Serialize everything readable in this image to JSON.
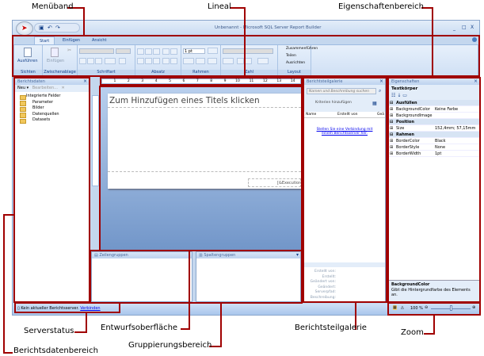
{
  "window": {
    "title": "Unbenannt - Microsoft SQL Server Report Builder"
  },
  "ribbon": {
    "tabs": [
      {
        "label": "Start"
      },
      {
        "label": "Einfügen"
      },
      {
        "label": "Ansicht"
      }
    ],
    "groups": {
      "sichten": "Sichten",
      "zwischenablage": "Zwischenablage",
      "schriftart": "Schriftart",
      "absatz": "Absatz",
      "rahmen": "Rahmen",
      "zahl": "Zahl",
      "layout": "Layout"
    },
    "run_label": "Ausführen",
    "paste_label": "Einfügen",
    "border_width": "1 pt",
    "layout_items": [
      "Zusammenführen",
      "Teilen",
      "Ausrichten"
    ]
  },
  "report_data": {
    "title": "Berichtsdaten",
    "new_label": "Neu",
    "edit_label": "Bearbeiten...",
    "items": [
      "Integrierte Felder",
      "Parameter",
      "Bilder",
      "Datenquellen",
      "Datasets"
    ]
  },
  "ruler": {
    "ticks": [
      "1",
      "2",
      "3",
      "4",
      "5",
      "6",
      "7",
      "8",
      "9",
      "10",
      "11",
      "12",
      "13",
      "14"
    ]
  },
  "design": {
    "title_placeholder": "Zum Hinzufügen eines Titels klicken",
    "footer_expr": "[&ExecutionTime]"
  },
  "grouping": {
    "row_groups": "Zeilengruppen",
    "column_groups": "Spaltengruppen"
  },
  "gallery": {
    "title": "Berichtsteilgalerie",
    "search_placeholder": "Namen und Beschreibung suchen",
    "add_criteria": "Kriterien hinzufügen",
    "columns": [
      "Name",
      "Erstellt von",
      "Geä"
    ],
    "connect_message": "Stellen Sie eine Verbindung mit einem Berichtsserver her.",
    "meta": [
      "Erstellt von:",
      "Erstellt:",
      "Geändert von:",
      "Geändert:",
      "Serverpfad:",
      "Beschreibung:"
    ]
  },
  "properties": {
    "title": "Eigenschaften",
    "object": "Textkörper",
    "rows": [
      {
        "type": "cat",
        "key": "Ausfüllen"
      },
      {
        "key": "BackgroundColor",
        "value": "Keine Farbe"
      },
      {
        "key": "BackgroundImage",
        "value": ""
      },
      {
        "type": "cat",
        "key": "Position"
      },
      {
        "key": "Size",
        "value": "152,4mm; 57,15mm"
      },
      {
        "type": "cat",
        "key": "Rahmen"
      },
      {
        "key": "BorderColor",
        "value": "Black"
      },
      {
        "key": "BorderStyle",
        "value": "None"
      },
      {
        "key": "BorderWidth",
        "value": "1pt"
      }
    ],
    "help_title": "BackgroundColor",
    "help_text": "Gibt die Hintergrundfarbe des Elements an."
  },
  "status": {
    "server": "Kein aktueller Berichtsserver.",
    "connect_link": "Verbinden",
    "zoom": "100 %"
  },
  "callouts": {
    "menuband": "Menüband",
    "lineal": "Lineal",
    "eigenschaften": "Eigenschaftenbereich",
    "serverstatus": "Serverstatus",
    "entwurf": "Entwurfsoberfläche",
    "gruppierung": "Gruppierungsbereich",
    "galerie": "Berichtsteilgalerie",
    "zoom": "Zoom",
    "berichtsdaten": "Berichtsdatenbereich"
  },
  "colors": {
    "callout": "#a00000",
    "ribbon": "#d0e0f5",
    "link": "#0000ee"
  }
}
